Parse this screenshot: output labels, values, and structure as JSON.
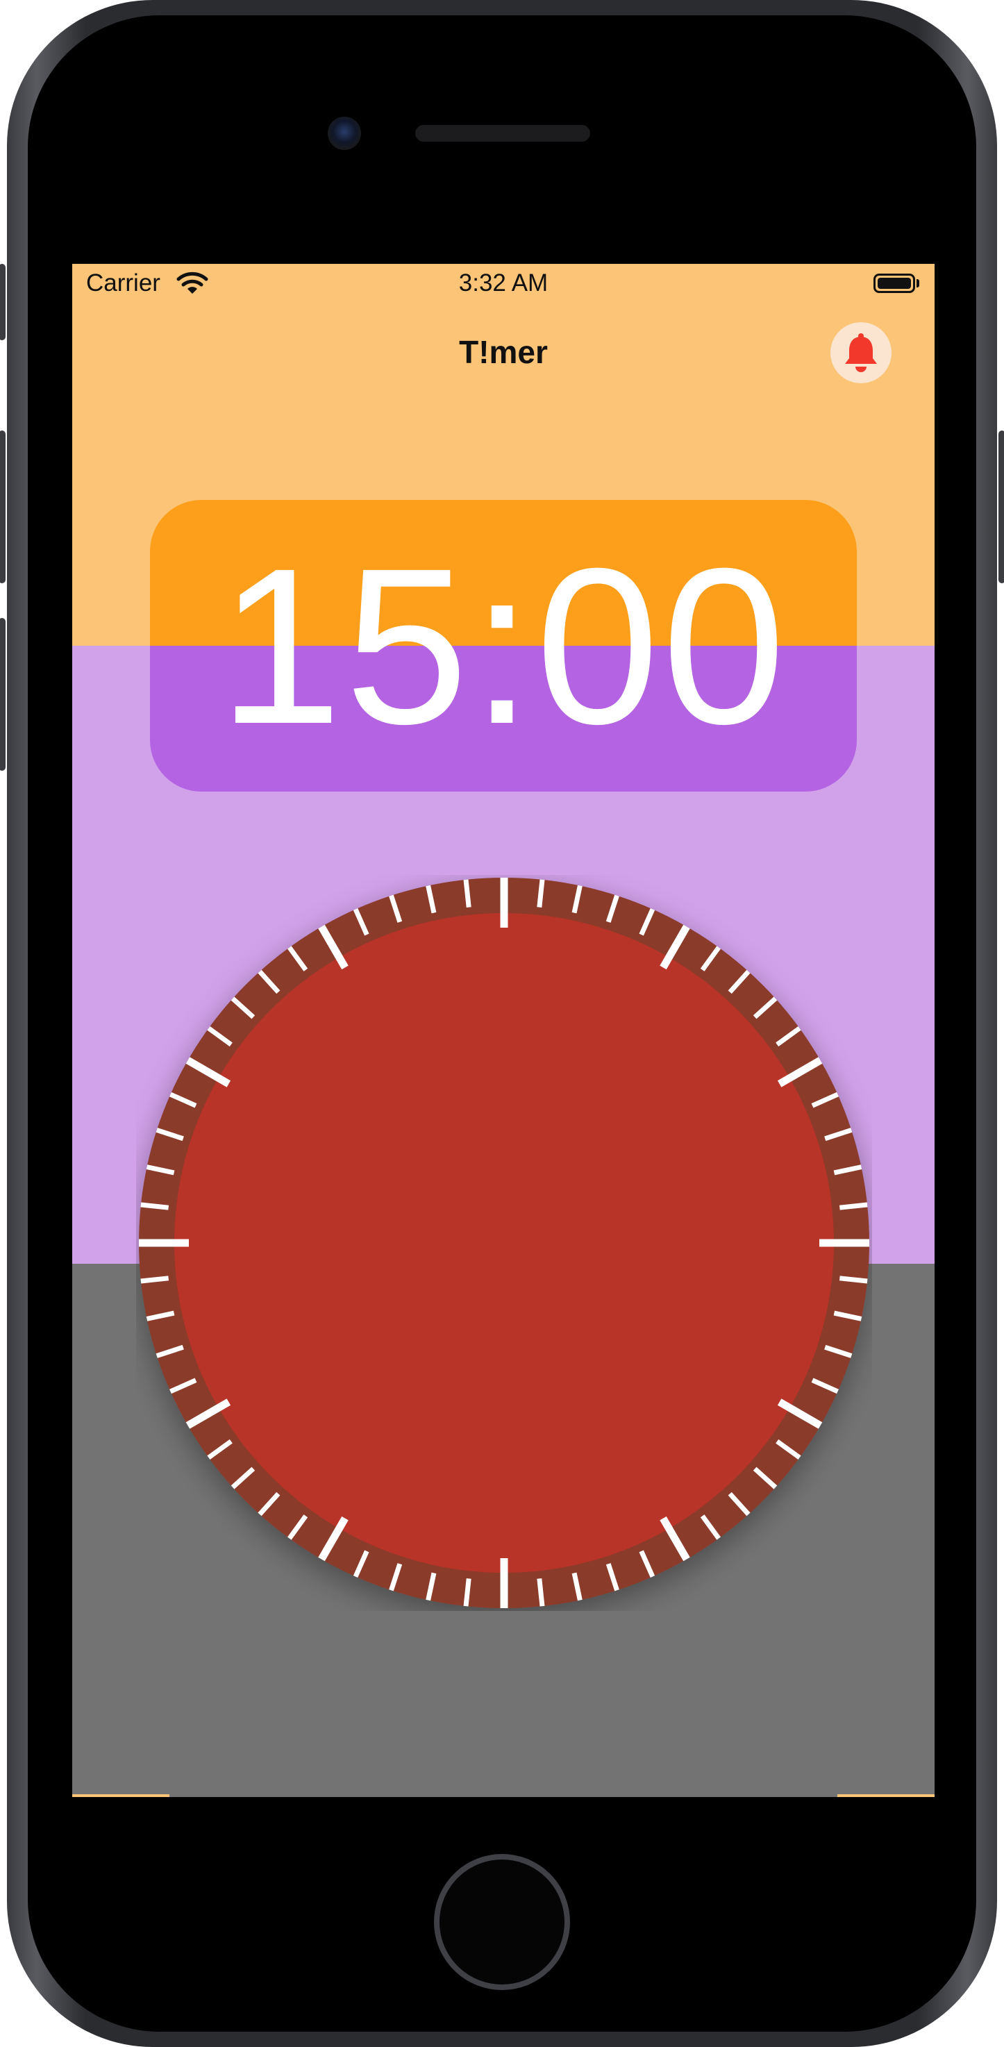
{
  "status_bar": {
    "carrier": "Carrier",
    "time": "3:32 AM",
    "wifi_icon": "wifi-icon",
    "battery_icon": "battery-full-icon"
  },
  "nav": {
    "title": "T!mer",
    "alarm_icon": "bell-icon"
  },
  "timer": {
    "display": "15:00"
  },
  "dial": {
    "tick_count": 60,
    "major_every": 5
  },
  "colors": {
    "top_background": "#fcc476",
    "middle_background": "#d1a1ea",
    "bottom_background": "#737373",
    "display_top": "#fe9f1b",
    "display_bottom": "#b463e3",
    "dial_face": "#b83328",
    "dial_rim": "#8a3a2c",
    "tick": "#ffffff",
    "bell": "#f2382b"
  }
}
